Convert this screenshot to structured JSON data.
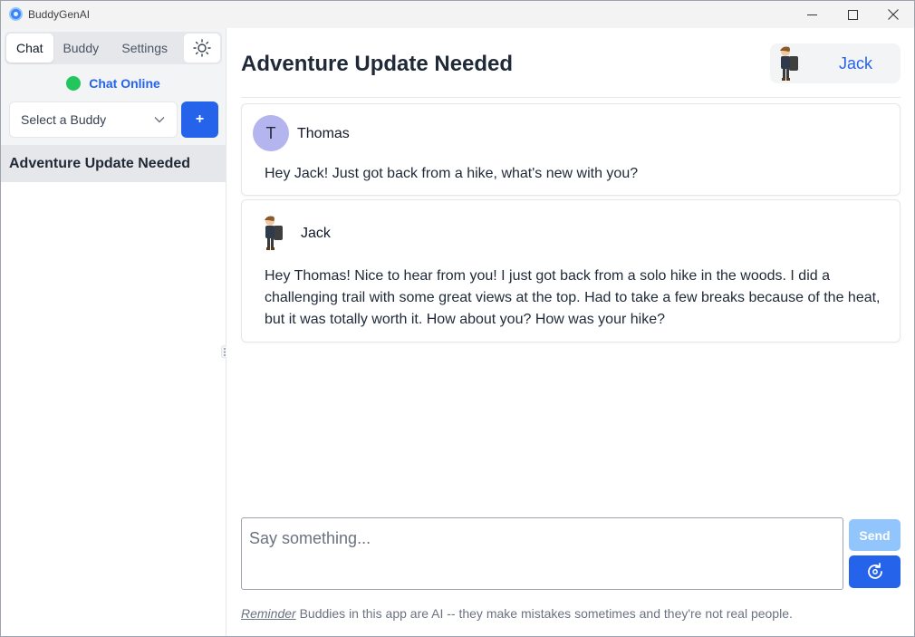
{
  "window": {
    "title": "BuddyGenAI",
    "app_icon": "chat-bubble-icon",
    "controls": [
      "minimize-icon",
      "maximize-icon",
      "close-icon"
    ]
  },
  "sidebar": {
    "tabs": [
      {
        "label": "Chat",
        "active": true
      },
      {
        "label": "Buddy",
        "active": false
      },
      {
        "label": "Settings",
        "active": false
      }
    ],
    "theme_toggle_icon": "sun-icon",
    "status": {
      "text": "Chat Online",
      "color": "#22c55e"
    },
    "buddy_select": {
      "value": "Select a Buddy",
      "icon": "chevron-down-icon"
    },
    "add_button_label": "+",
    "chats": [
      {
        "title": "Adventure Update Needed",
        "active": true
      }
    ]
  },
  "main": {
    "title": "Adventure Update Needed",
    "buddy_badge": {
      "name": "Jack",
      "avatar": "hiker-avatar"
    },
    "messages": [
      {
        "author": "Thomas",
        "avatar_letter": "T",
        "text": "Hey Jack! Just got back from a hike, what's new with you?"
      },
      {
        "author": "Jack",
        "avatar": "hiker-avatar",
        "text": "Hey Thomas! Nice to hear from you! I just got back from a solo hike in the woods. I did a challenging trail with some great views at the top. Had to take a few breaks because of the heat, but it was totally worth it. How about you? How was your hike?"
      }
    ],
    "composer": {
      "placeholder": "Say something...",
      "value": ""
    },
    "send_label": "Send",
    "regenerate_icon": "refresh-icon",
    "reminder": {
      "label": "Reminder",
      "text": "Buddies in this app are AI -- they make mistakes sometimes and they're not real people."
    }
  },
  "colors": {
    "accent": "#2563eb",
    "accent_disabled": "#93c5fd",
    "online": "#22c55e",
    "avatar_bg": "#b4b4ee"
  }
}
